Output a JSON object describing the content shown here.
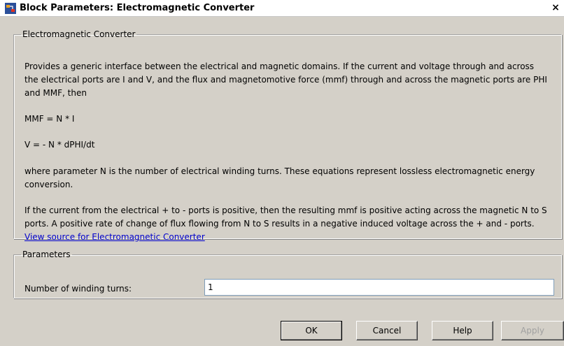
{
  "window": {
    "title": "Block Parameters: Electromagnetic Converter",
    "close_glyph": "×"
  },
  "description_group": {
    "legend": "Electromagnetic Converter",
    "paragraphs": [
      "Provides a generic interface between the electrical and magnetic domains. If the current and voltage through and across the electrical ports are I and V, and the flux and magnetomotive force (mmf) through and across the magnetic ports are PHI and MMF, then",
      "MMF = N * I",
      "V = - N * dPHI/dt",
      "where parameter N is the number of electrical winding turns. These equations represent lossless electromagnetic energy conversion.",
      "If the current from the electrical + to - ports is positive, then the resulting mmf is positive acting across the magnetic N to S ports. A positive rate of change of flux flowing from N to S results in a negative induced voltage across the + and - ports."
    ],
    "link": "View source for Electromagnetic Converter"
  },
  "parameters_group": {
    "legend": "Parameters",
    "winding_label": "Number of winding turns:",
    "winding_value": "1"
  },
  "buttons": {
    "ok": "OK",
    "cancel": "Cancel",
    "help": "Help",
    "apply": "Apply"
  }
}
